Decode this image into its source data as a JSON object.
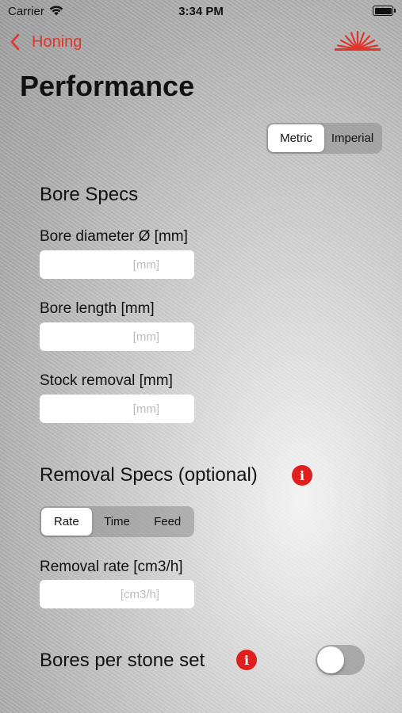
{
  "status_bar": {
    "carrier": "Carrier",
    "time": "3:34 PM"
  },
  "nav": {
    "back_label": "Honing"
  },
  "page": {
    "title": "Performance"
  },
  "units": {
    "options": [
      "Metric",
      "Imperial"
    ],
    "selected": "Metric"
  },
  "bore_specs": {
    "heading": "Bore Specs",
    "fields": [
      {
        "label": "Bore diameter Ø [mm]",
        "placeholder": "[mm]",
        "value": ""
      },
      {
        "label": "Bore length [mm]",
        "placeholder": "[mm]",
        "value": ""
      },
      {
        "label": "Stock removal [mm]",
        "placeholder": "[mm]",
        "value": ""
      }
    ]
  },
  "removal_specs": {
    "heading": "Removal Specs (optional)",
    "info_glyph": "i",
    "modes": [
      "Rate",
      "Time",
      "Feed"
    ],
    "selected_mode": "Rate",
    "field": {
      "label": "Removal rate [cm3/h]",
      "placeholder": "[cm3/h]",
      "value": ""
    }
  },
  "stones": {
    "label": "Bores per stone set",
    "info_glyph": "i",
    "toggle_on": false
  },
  "colors": {
    "accent": "#e0352b",
    "info": "#e01e1e"
  }
}
